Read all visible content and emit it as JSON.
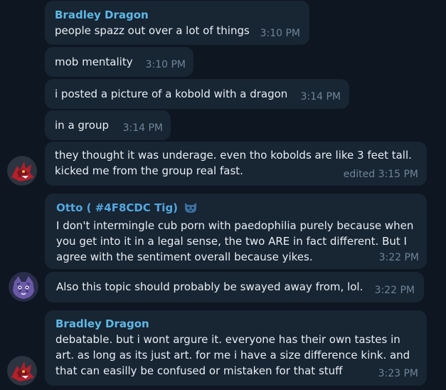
{
  "messages": [
    {
      "sender": "Bradley Dragon",
      "text": "people spazz out over a lot of things",
      "time": "3:10 PM"
    },
    {
      "text": "mob mentality",
      "time": "3:10 PM"
    },
    {
      "text": "i posted a picture of a kobold with a dragon",
      "time": "3:14 PM"
    },
    {
      "text": "in a group",
      "time": "3:14 PM"
    },
    {
      "line1": "they thought it was underage. even tho kobolds are like 3 feet tall.",
      "line2": "kicked me from the group real fast.",
      "time": "edited 3:15 PM"
    },
    {
      "sender": "Otto ( #4F8CDC Tig)",
      "line1": "I don't intermingle cub porn with paedophilia purely because when",
      "line2": "you get into it in a legal sense, the two ARE in fact different. But I",
      "line3": "agree with the sentiment overall because yikes.",
      "time": "3:22 PM"
    },
    {
      "text": "Also this topic should probably be swayed away from, lol.",
      "time": "3:22 PM"
    },
    {
      "sender": "Bradley Dragon",
      "line1": "debatable. but i wont argure it. everyone has their own tastes in",
      "line2": "art. as long as its just art. for me i have a size difference kink. and",
      "line3": "that can easilly be confused or mistaken for that stuff",
      "time": "3:23 PM"
    }
  ],
  "icons": {
    "dragon_avatar": "dragon-avatar",
    "otto_avatar": "tiger-avatar",
    "otto_badge": "cat-emoji-icon"
  },
  "colors": {
    "background": "#0e1621",
    "bubble": "#182533",
    "sender_name": "#5fb8e6",
    "time": "#6f8597"
  }
}
